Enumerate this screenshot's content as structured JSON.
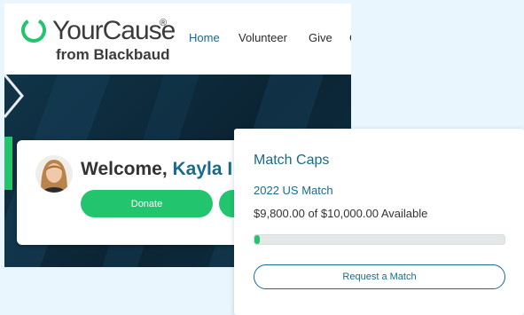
{
  "logo": {
    "name": "YourCause",
    "registered": "®",
    "subtitle": "from Blackbaud"
  },
  "nav": {
    "items": [
      {
        "label": "Home",
        "active": true
      },
      {
        "label": "Volunteer"
      },
      {
        "label": "Give"
      },
      {
        "label": "C"
      }
    ]
  },
  "welcome": {
    "greeting": "Welcome,",
    "name": "Kayla",
    "cut_off": "I",
    "donate_label": "Donate"
  },
  "match_caps": {
    "title": "Match Caps",
    "program": "2022 US Match",
    "available_text": "$9,800.00 of $10,000.00 Available",
    "used_fraction": 0.02,
    "request_label": "Request a Match"
  },
  "colors": {
    "brand_green": "#22c46d",
    "accent_blue": "#1a6b8a",
    "hero_dark": "#0e2a3b"
  }
}
